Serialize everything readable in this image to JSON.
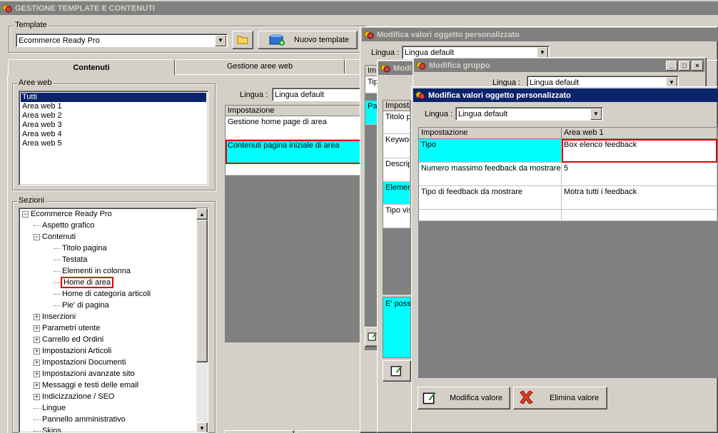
{
  "app": {
    "title": "GESTIONE TEMPLATE E CONTENUTI"
  },
  "template": {
    "group_label": "Template",
    "selected": "Ecommerce Ready Pro",
    "new_button": "Nuovo template"
  },
  "tabs": [
    {
      "label": "Contenuti"
    },
    {
      "label": "Gestione aree web"
    }
  ],
  "aree_web": {
    "group_label": "Aree web",
    "items": [
      "Tutti",
      "Area web 1",
      "Area web 2",
      "Area web 3",
      "Area web 4",
      "Area web 5"
    ]
  },
  "sezioni": {
    "group_label": "Sezioni",
    "root": "Ecommerce Ready Pro",
    "items": [
      "Aspetto grafico",
      "Contenuti",
      "Titolo pagina",
      "Testata",
      "Elementi in colonna",
      "Home di area",
      "Home di categoria articoli",
      "Pie' di pagina",
      "Inserzioni",
      "Parametri utente",
      "Carrello ed Ordini",
      "Impostazioni Articoli",
      "Impostazioni Documenti",
      "Impostazioni avanzate sito",
      "Messaggi e testi delle email",
      "Indicizzazione / SEO",
      "Lingue",
      "Pannello amministrativo",
      "Skins"
    ]
  },
  "main": {
    "lingua_label": "Lingua :",
    "lingua_value": "Lingua default",
    "grid_header": "Impostazione",
    "rows": [
      "Gestione home page di area",
      "Contenuti pagina iniziale di area"
    ]
  },
  "dialog1": {
    "title": "Modifica valori oggetto personalizzato",
    "lingua_label": "Lingua :",
    "lingua_value": "Lingua default",
    "header_fragment": "Im",
    "row_fragment": "Tip",
    "cell_fragment": "Pa"
  },
  "dialog2": {
    "title_fragment": "Modi"
  },
  "dialog_gruppo": {
    "title": "Modifica gruppo",
    "lingua_label": "Lingua :",
    "lingua_value": "Lingua default",
    "win_min": "_",
    "win_max": "□",
    "win_close": "×"
  },
  "dialog2_rows": {
    "header": "Impostazione",
    "items": [
      "Titolo p",
      "Keywor",
      "Descrip",
      "Elemen",
      "Tipo vis"
    ],
    "info": "E' possi"
  },
  "dialog3": {
    "title": "Modifica valori oggetto personalizzato",
    "lingua_label": "Lingua :",
    "lingua_value": "Lingua default",
    "col_setting": "Impostazione",
    "col_area": "Area web 1",
    "rows": [
      {
        "setting": "Tipo",
        "value": "Box elenco feedback"
      },
      {
        "setting": "Numero massimo feedback da mostrare",
        "value": "5"
      },
      {
        "setting": "Tipo di feedback da mostrare",
        "value": "Motra tutti i feedback"
      }
    ],
    "btn_modifica": "Modifica valore",
    "btn_elimina": "Elimina valore"
  },
  "colors": {
    "selection": "#0a246a",
    "highlight": "#00ffff",
    "annotation": "#e00000"
  }
}
